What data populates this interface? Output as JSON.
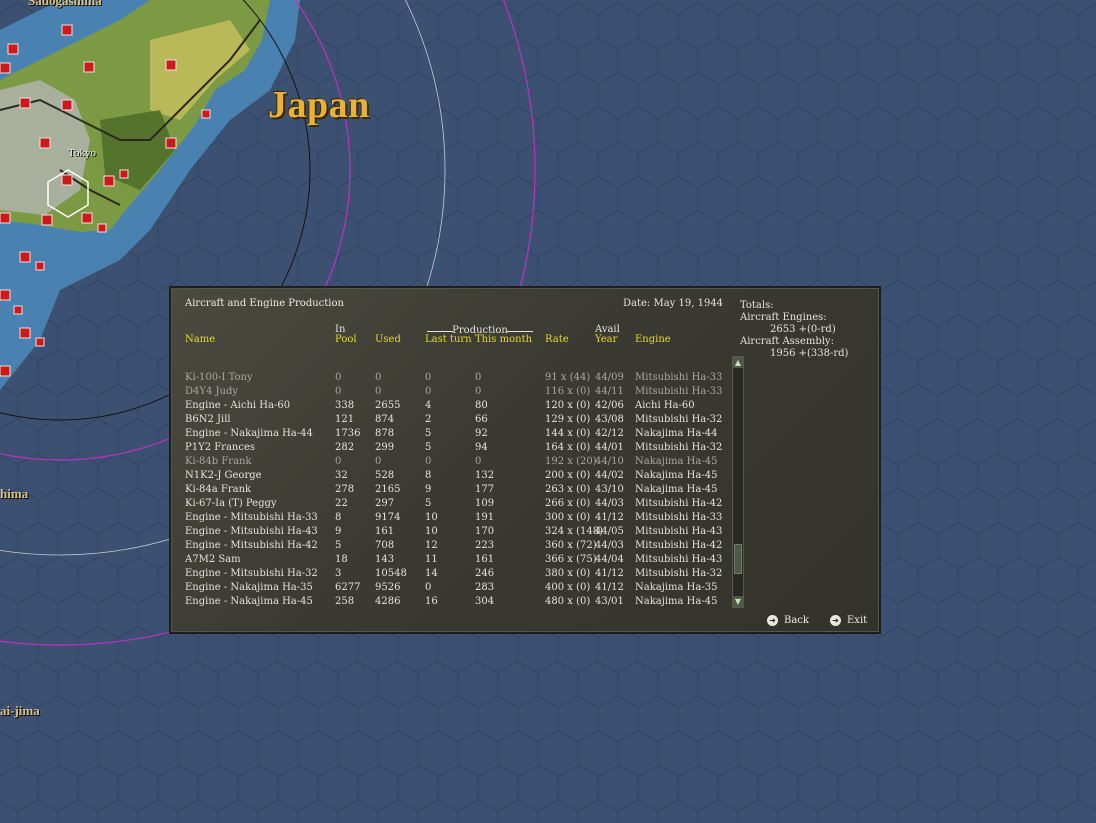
{
  "map": {
    "region_label": "Japan",
    "city_label": "Tokyo",
    "edge_labels": [
      "Sadogashima",
      "hima",
      "ai-jima"
    ],
    "colors": {
      "sea": "#3c5172",
      "coast": "#4a86b8",
      "land": "#8aa84a",
      "label": "#e8b23a"
    }
  },
  "dialog": {
    "title": "Aircraft and Engine Production",
    "date_label": "Date:",
    "date": "May 19, 1944",
    "totals": {
      "heading": "Totals:",
      "engines_label": "Aircraft Engines:",
      "engines_value": "2653 +(0-rd)",
      "assembly_label": "Aircraft Assembly:",
      "assembly_value": "1956 +(338-rd)"
    },
    "headers": {
      "name": "Name",
      "in": "In",
      "pool": "Pool",
      "used": "Used",
      "production": "Production",
      "last_turn": "Last turn",
      "this_month": "This month",
      "rate": "Rate",
      "avail": "Avail",
      "year": "Year",
      "engine": "Engine"
    },
    "rows": [
      {
        "name": "Ki-100-I Tony",
        "pool": "0",
        "used": "0",
        "last": "0",
        "month": "0",
        "rate": "91 x (44)",
        "year": "44/09",
        "engine": "Mitsubishi Ha-33",
        "dim": true
      },
      {
        "name": "D4Y4 Judy",
        "pool": "0",
        "used": "0",
        "last": "0",
        "month": "0",
        "rate": "116 x (0)",
        "year": "44/11",
        "engine": "Mitsubishi Ha-33",
        "dim": true
      },
      {
        "name": "Engine - Aichi Ha-60",
        "pool": "338",
        "used": "2655",
        "last": "4",
        "month": "80",
        "rate": "120 x (0)",
        "year": "42/06",
        "engine": "Aichi Ha-60",
        "dim": false
      },
      {
        "name": "B6N2 Jill",
        "pool": "121",
        "used": "874",
        "last": "2",
        "month": "66",
        "rate": "129 x (0)",
        "year": "43/08",
        "engine": "Mitsubishi Ha-32",
        "dim": false
      },
      {
        "name": "Engine - Nakajima Ha-44",
        "pool": "1736",
        "used": "878",
        "last": "5",
        "month": "92",
        "rate": "144 x (0)",
        "year": "42/12",
        "engine": "Nakajima Ha-44",
        "dim": false
      },
      {
        "name": "P1Y2 Frances",
        "pool": "282",
        "used": "299",
        "last": "5",
        "month": "94",
        "rate": "164 x (0)",
        "year": "44/01",
        "engine": "Mitsubishi Ha-32",
        "dim": false
      },
      {
        "name": "Ki-84b Frank",
        "pool": "0",
        "used": "0",
        "last": "0",
        "month": "0",
        "rate": "192 x (20)",
        "year": "44/10",
        "engine": "Nakajima Ha-45",
        "dim": true
      },
      {
        "name": "N1K2-J George",
        "pool": "32",
        "used": "528",
        "last": "8",
        "month": "132",
        "rate": "200 x (0)",
        "year": "44/02",
        "engine": "Nakajima Ha-45",
        "dim": false
      },
      {
        "name": "Ki-84a Frank",
        "pool": "278",
        "used": "2165",
        "last": "9",
        "month": "177",
        "rate": "263 x (0)",
        "year": "43/10",
        "engine": "Nakajima Ha-45",
        "dim": false
      },
      {
        "name": "Ki-67-Ia (T) Peggy",
        "pool": "22",
        "used": "297",
        "last": "5",
        "month": "109",
        "rate": "266 x (0)",
        "year": "44/03",
        "engine": "Mitsubishi Ha-42",
        "dim": false
      },
      {
        "name": "Engine - Mitsubishi Ha-33",
        "pool": "8",
        "used": "9174",
        "last": "10",
        "month": "191",
        "rate": "300 x (0)",
        "year": "41/12",
        "engine": "Mitsubishi Ha-33",
        "dim": false
      },
      {
        "name": "Engine - Mitsubishi Ha-43",
        "pool": "9",
        "used": "161",
        "last": "10",
        "month": "170",
        "rate": "324 x (148)",
        "year": "44/05",
        "engine": "Mitsubishi Ha-43",
        "dim": false
      },
      {
        "name": "Engine - Mitsubishi Ha-42",
        "pool": "5",
        "used": "708",
        "last": "12",
        "month": "223",
        "rate": "360 x (72)",
        "year": "44/03",
        "engine": "Mitsubishi Ha-42",
        "dim": false
      },
      {
        "name": "A7M2 Sam",
        "pool": "18",
        "used": "143",
        "last": "11",
        "month": "161",
        "rate": "366 x (75)",
        "year": "44/04",
        "engine": "Mitsubishi Ha-43",
        "dim": false
      },
      {
        "name": "Engine - Mitsubishi Ha-32",
        "pool": "3",
        "used": "10548",
        "last": "14",
        "month": "246",
        "rate": "380 x (0)",
        "year": "41/12",
        "engine": "Mitsubishi Ha-32",
        "dim": false
      },
      {
        "name": "Engine - Nakajima Ha-35",
        "pool": "6277",
        "used": "9526",
        "last": "0",
        "month": "283",
        "rate": "400 x (0)",
        "year": "41/12",
        "engine": "Nakajima Ha-35",
        "dim": false
      },
      {
        "name": "Engine - Nakajima Ha-45",
        "pool": "258",
        "used": "4286",
        "last": "16",
        "month": "304",
        "rate": "480 x (0)",
        "year": "43/01",
        "engine": "Nakajima Ha-45",
        "dim": false
      }
    ],
    "buttons": {
      "back": "Back",
      "exit": "Exit"
    },
    "scroll_position": 0.88
  }
}
